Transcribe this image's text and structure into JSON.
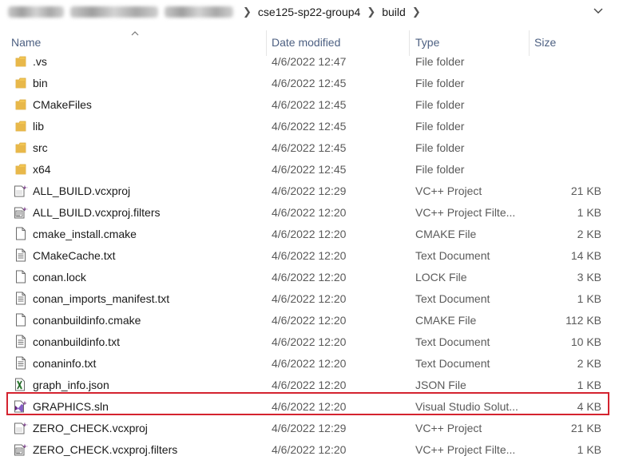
{
  "address_bar": {
    "crumbs": [
      "cse125-sp22-group4",
      "build"
    ]
  },
  "columns": {
    "name": "Name",
    "date": "Date modified",
    "type": "Type",
    "size": "Size"
  },
  "files": [
    {
      "name": ".vs",
      "date": "4/6/2022 12:47",
      "type": "File folder",
      "size": "",
      "icon": "folder-icon"
    },
    {
      "name": "bin",
      "date": "4/6/2022 12:45",
      "type": "File folder",
      "size": "",
      "icon": "folder-icon"
    },
    {
      "name": "CMakeFiles",
      "date": "4/6/2022 12:45",
      "type": "File folder",
      "size": "",
      "icon": "folder-icon"
    },
    {
      "name": "lib",
      "date": "4/6/2022 12:45",
      "type": "File folder",
      "size": "",
      "icon": "folder-icon"
    },
    {
      "name": "src",
      "date": "4/6/2022 12:45",
      "type": "File folder",
      "size": "",
      "icon": "folder-icon"
    },
    {
      "name": "x64",
      "date": "4/6/2022 12:45",
      "type": "File folder",
      "size": "",
      "icon": "folder-icon"
    },
    {
      "name": "ALL_BUILD.vcxproj",
      "date": "4/6/2022 12:29",
      "type": "VC++ Project",
      "size": "21 KB",
      "icon": "vcxproj-icon"
    },
    {
      "name": "ALL_BUILD.vcxproj.filters",
      "date": "4/6/2022 12:20",
      "type": "VC++ Project Filte...",
      "size": "1 KB",
      "icon": "filters-icon"
    },
    {
      "name": "cmake_install.cmake",
      "date": "4/6/2022 12:20",
      "type": "CMAKE File",
      "size": "2 KB",
      "icon": "file-icon"
    },
    {
      "name": "CMakeCache.txt",
      "date": "4/6/2022 12:20",
      "type": "Text Document",
      "size": "14 KB",
      "icon": "text-file-icon"
    },
    {
      "name": "conan.lock",
      "date": "4/6/2022 12:20",
      "type": "LOCK File",
      "size": "3 KB",
      "icon": "file-icon"
    },
    {
      "name": "conan_imports_manifest.txt",
      "date": "4/6/2022 12:20",
      "type": "Text Document",
      "size": "1 KB",
      "icon": "text-file-icon"
    },
    {
      "name": "conanbuildinfo.cmake",
      "date": "4/6/2022 12:20",
      "type": "CMAKE File",
      "size": "112 KB",
      "icon": "file-icon"
    },
    {
      "name": "conanbuildinfo.txt",
      "date": "4/6/2022 12:20",
      "type": "Text Document",
      "size": "10 KB",
      "icon": "text-file-icon"
    },
    {
      "name": "conaninfo.txt",
      "date": "4/6/2022 12:20",
      "type": "Text Document",
      "size": "2 KB",
      "icon": "text-file-icon"
    },
    {
      "name": "graph_info.json",
      "date": "4/6/2022 12:20",
      "type": "JSON File",
      "size": "1 KB",
      "icon": "json-file-icon"
    },
    {
      "name": "GRAPHICS.sln",
      "date": "4/6/2022 12:20",
      "type": "Visual Studio Solut...",
      "size": "4 KB",
      "icon": "visual-studio-solution-icon"
    },
    {
      "name": "ZERO_CHECK.vcxproj",
      "date": "4/6/2022 12:29",
      "type": "VC++ Project",
      "size": "21 KB",
      "icon": "vcxproj-icon"
    },
    {
      "name": "ZERO_CHECK.vcxproj.filters",
      "date": "4/6/2022 12:20",
      "type": "VC++ Project Filte...",
      "size": "1 KB",
      "icon": "filters-icon"
    }
  ],
  "colors": {
    "folder": "#e8b84a",
    "highlight": "#d4232f",
    "header_text": "#4d6082",
    "vs_purple": "#68217a"
  }
}
